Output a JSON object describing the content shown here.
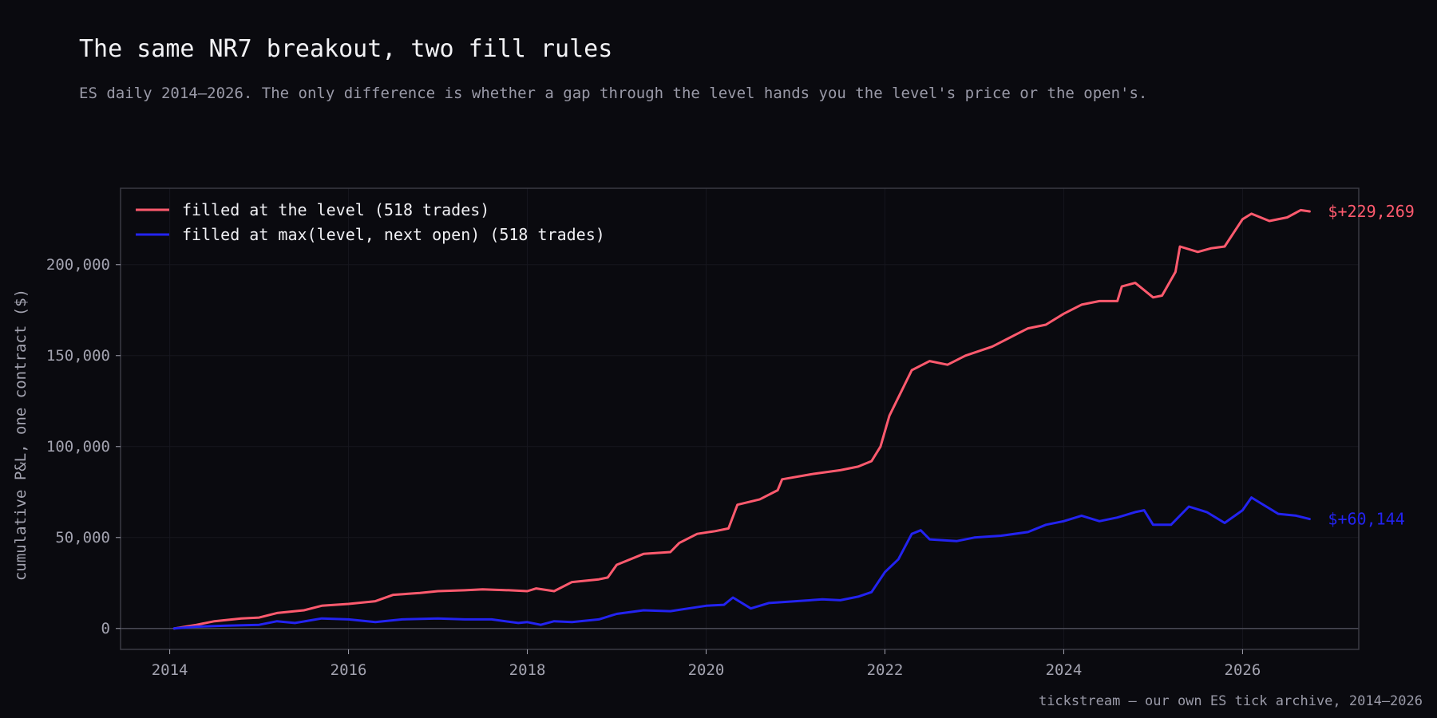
{
  "title": "The same NR7 breakout, two fill rules",
  "subtitle": "ES daily 2014–2026. The only difference is whether a gap through the level hands you the level's price or the open's.",
  "source": "tickstream — our own ES tick archive, 2014–2026",
  "colors": {
    "background": "#0a0a0f",
    "level": "#ff5a6e",
    "max": "#2323f0",
    "axis": "#3a3a44",
    "grid": "#16161e",
    "zero": "#4a4a55"
  },
  "chart_data": {
    "type": "line",
    "title": "The same NR7 breakout, two fill rules",
    "xlabel": "",
    "ylabel": "cumulative P&L, one contract ($)",
    "xlim": [
      2013.45,
      2027.3
    ],
    "ylim": [
      -11500,
      242000
    ],
    "grid": true,
    "legend_position": "top-left",
    "x_ticks": [
      2014,
      2016,
      2018,
      2020,
      2022,
      2024,
      2026
    ],
    "x_tick_labels": [
      "2014",
      "2016",
      "2018",
      "2020",
      "2022",
      "2024",
      "2026"
    ],
    "y_ticks": [
      0,
      50000,
      100000,
      150000,
      200000
    ],
    "y_tick_labels": [
      "0",
      "50,000",
      "100,000",
      "150,000",
      "200,000"
    ],
    "series": [
      {
        "name": "filled at the level  (518 trades)",
        "color": "#ff5a6e",
        "end_label": "$+229,269",
        "x": [
          2014.05,
          2014.3,
          2014.5,
          2014.8,
          2015.0,
          2015.2,
          2015.5,
          2015.7,
          2016.0,
          2016.3,
          2016.5,
          2016.8,
          2017.0,
          2017.3,
          2017.5,
          2017.8,
          2018.0,
          2018.1,
          2018.3,
          2018.5,
          2018.8,
          2018.9,
          2019.0,
          2019.3,
          2019.6,
          2019.7,
          2019.9,
          2020.1,
          2020.25,
          2020.35,
          2020.6,
          2020.8,
          2020.85,
          2021.2,
          2021.5,
          2021.7,
          2021.85,
          2021.95,
          2022.05,
          2022.2,
          2022.3,
          2022.5,
          2022.7,
          2022.9,
          2023.2,
          2023.4,
          2023.6,
          2023.8,
          2024.0,
          2024.2,
          2024.4,
          2024.6,
          2024.65,
          2024.8,
          2025.0,
          2025.1,
          2025.25,
          2025.3,
          2025.5,
          2025.65,
          2025.8,
          2026.0,
          2026.1,
          2026.3,
          2026.5,
          2026.65,
          2026.75
        ],
        "y": [
          0,
          2000,
          4000,
          5500,
          6000,
          8500,
          10000,
          12500,
          13500,
          15000,
          18500,
          19500,
          20500,
          21000,
          21500,
          21000,
          20500,
          22000,
          20500,
          25500,
          27000,
          28000,
          35000,
          41000,
          42000,
          47000,
          52000,
          53500,
          55000,
          68000,
          71000,
          76000,
          82000,
          85000,
          87000,
          89000,
          92000,
          100000,
          117000,
          132000,
          142000,
          147000,
          145000,
          150000,
          155000,
          160000,
          165000,
          167000,
          173000,
          178000,
          180000,
          180000,
          188000,
          190000,
          182000,
          183000,
          196000,
          210000,
          207000,
          209000,
          210000,
          225000,
          228000,
          224000,
          226000,
          230000,
          229269
        ]
      },
      {
        "name": "filled at max(level, next open)  (518 trades)",
        "color": "#2323f0",
        "end_label": "$+60,144",
        "x": [
          2014.05,
          2014.3,
          2014.6,
          2015.0,
          2015.2,
          2015.4,
          2015.7,
          2016.0,
          2016.3,
          2016.6,
          2017.0,
          2017.3,
          2017.6,
          2017.9,
          2018.0,
          2018.15,
          2018.3,
          2018.5,
          2018.8,
          2019.0,
          2019.3,
          2019.6,
          2019.8,
          2020.0,
          2020.2,
          2020.3,
          2020.5,
          2020.7,
          2021.0,
          2021.3,
          2021.5,
          2021.7,
          2021.85,
          2022.0,
          2022.15,
          2022.3,
          2022.4,
          2022.5,
          2022.8,
          2023.0,
          2023.3,
          2023.6,
          2023.8,
          2024.0,
          2024.2,
          2024.4,
          2024.6,
          2024.8,
          2024.9,
          2025.0,
          2025.2,
          2025.4,
          2025.6,
          2025.8,
          2026.0,
          2026.1,
          2026.2,
          2026.4,
          2026.6,
          2026.75
        ],
        "y": [
          0,
          1000,
          1500,
          2000,
          4000,
          3000,
          5500,
          5000,
          3500,
          5000,
          5500,
          5000,
          5000,
          3000,
          3500,
          2000,
          4000,
          3500,
          5000,
          8000,
          10000,
          9500,
          11000,
          12500,
          13000,
          17000,
          11000,
          14000,
          15000,
          16000,
          15500,
          17500,
          20000,
          31000,
          38000,
          52000,
          54000,
          49000,
          48000,
          50000,
          51000,
          53000,
          57000,
          59000,
          62000,
          59000,
          61000,
          64000,
          65000,
          57000,
          57000,
          67000,
          64000,
          58000,
          65000,
          72000,
          69000,
          63000,
          62000,
          60144
        ]
      }
    ]
  }
}
